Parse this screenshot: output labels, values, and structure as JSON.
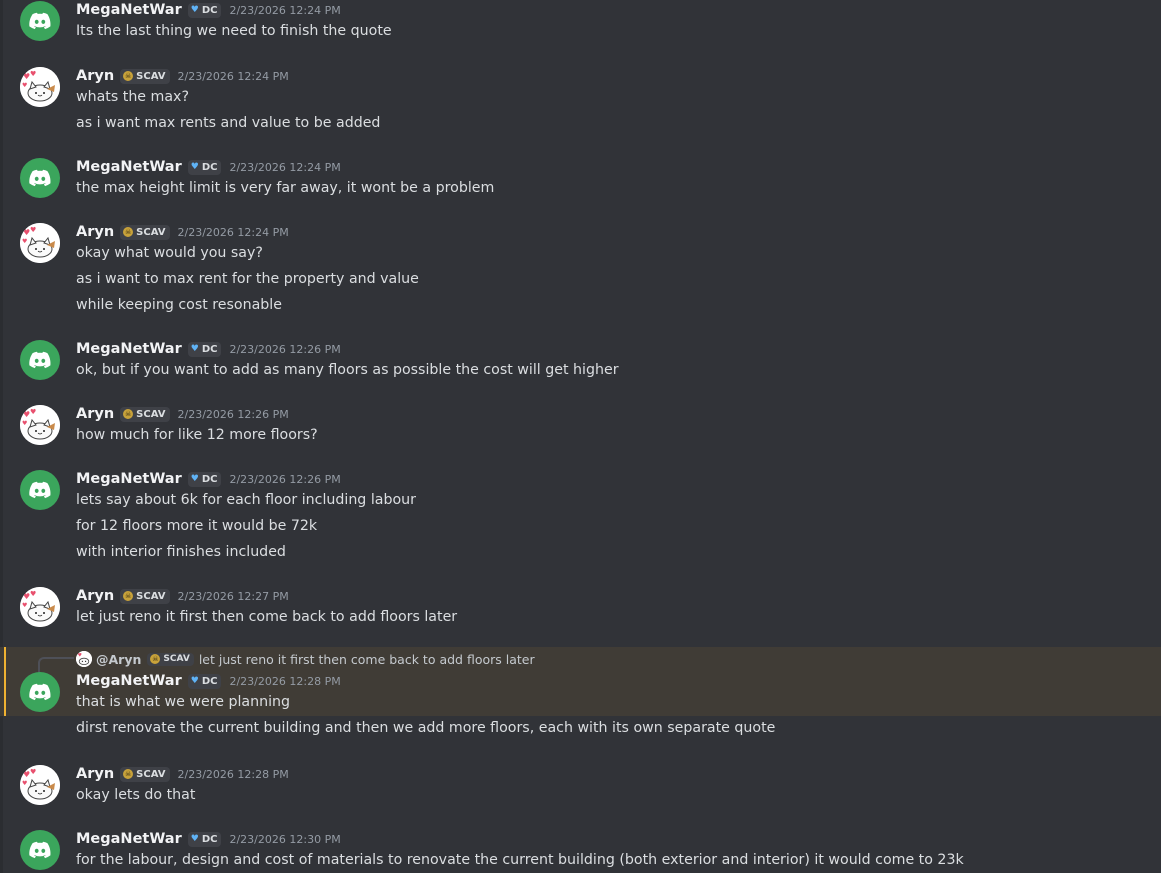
{
  "messages": [
    {
      "author": "MegaNetWar",
      "avatar": "discord-logo-icon",
      "tag": {
        "icon": "blue-heart-icon",
        "label": "DC"
      },
      "timestamp": "2/23/2026 12:24 PM",
      "lines": [
        "Its the last thing we need to finish the quote"
      ]
    },
    {
      "author": "Aryn",
      "avatar": "cat-avatar-icon",
      "tag": {
        "icon": "skull-icon",
        "label": "SCAV"
      },
      "timestamp": "2/23/2026 12:24 PM",
      "lines": [
        "whats the max?",
        "as i want max rents and value to be added"
      ]
    },
    {
      "author": "MegaNetWar",
      "avatar": "discord-logo-icon",
      "tag": {
        "icon": "blue-heart-icon",
        "label": "DC"
      },
      "timestamp": "2/23/2026 12:24 PM",
      "lines": [
        "the max height limit is very far away, it wont be a problem"
      ]
    },
    {
      "author": "Aryn",
      "avatar": "cat-avatar-icon",
      "tag": {
        "icon": "skull-icon",
        "label": "SCAV"
      },
      "timestamp": "2/23/2026 12:24 PM",
      "lines": [
        "okay what would you say?",
        "as i want to max rent for the property and value",
        "while keeping cost resonable"
      ]
    },
    {
      "author": "MegaNetWar",
      "avatar": "discord-logo-icon",
      "tag": {
        "icon": "blue-heart-icon",
        "label": "DC"
      },
      "timestamp": "2/23/2026 12:26 PM",
      "lines": [
        "ok, but if you want to add as many floors as possible the cost will get higher"
      ]
    },
    {
      "author": "Aryn",
      "avatar": "cat-avatar-icon",
      "tag": {
        "icon": "skull-icon",
        "label": "SCAV"
      },
      "timestamp": "2/23/2026 12:26 PM",
      "lines": [
        "how much for like 12 more floors?"
      ]
    },
    {
      "author": "MegaNetWar",
      "avatar": "discord-logo-icon",
      "tag": {
        "icon": "blue-heart-icon",
        "label": "DC"
      },
      "timestamp": "2/23/2026 12:26 PM",
      "lines": [
        "lets say about 6k for each floor including labour",
        "for 12 floors more it would be 72k",
        "with interior finishes included"
      ]
    },
    {
      "author": "Aryn",
      "avatar": "cat-avatar-icon",
      "tag": {
        "icon": "skull-icon",
        "label": "SCAV"
      },
      "timestamp": "2/23/2026 12:27 PM",
      "lines": [
        "let just reno it first then come back to add floors later"
      ]
    },
    {
      "author": "MegaNetWar",
      "avatar": "discord-logo-icon",
      "tag": {
        "icon": "blue-heart-icon",
        "label": "DC"
      },
      "timestamp": "2/23/2026 12:28 PM",
      "highlighted": true,
      "reply": {
        "author": "@Aryn",
        "tag": {
          "icon": "skull-icon",
          "label": "SCAV"
        },
        "text": "let just reno it first then come back to add floors later"
      },
      "lines": [
        "that is what we were planning",
        "dirst renovate the current building and then we add more floors, each with its own separate quote"
      ]
    },
    {
      "author": "Aryn",
      "avatar": "cat-avatar-icon",
      "tag": {
        "icon": "skull-icon",
        "label": "SCAV"
      },
      "timestamp": "2/23/2026 12:28 PM",
      "lines": [
        "okay lets do that"
      ]
    },
    {
      "author": "MegaNetWar",
      "avatar": "discord-logo-icon",
      "tag": {
        "icon": "blue-heart-icon",
        "label": "DC"
      },
      "timestamp": "2/23/2026 12:30 PM",
      "lines": [
        "for the labour, design and cost of materials to renovate the current building (both exterior and interior) it would come to 23k"
      ]
    }
  ]
}
